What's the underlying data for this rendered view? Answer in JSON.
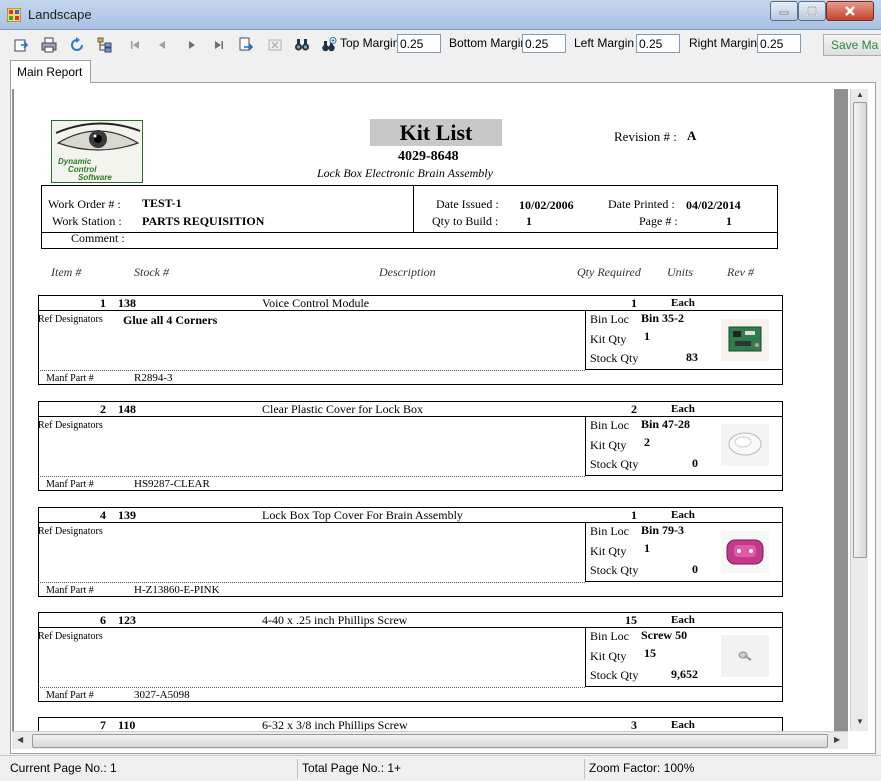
{
  "window": {
    "title": "Landscape"
  },
  "toolbar": {
    "top_margin_label": "Top Margin",
    "top_margin_value": "0.25",
    "bottom_margin_label": "Bottom Margin",
    "bottom_margin_value": "0.25",
    "left_margin_label": "Left Margin",
    "left_margin_value": "0.25",
    "right_margin_label": "Right Margin",
    "right_margin_value": "0.25",
    "save_label": "Save Ma"
  },
  "tabs": [
    {
      "label": "Main Report"
    }
  ],
  "report": {
    "logo_text": [
      "Dynamic",
      "Control",
      "Software"
    ],
    "title": "Kit List",
    "kit_number": "4029-8648",
    "kit_description": "Lock Box Electronic Brain Assembly",
    "revision_label": "Revision # :",
    "revision_value": "A",
    "header": {
      "work_order_label": "Work Order # :",
      "work_order_value": "TEST-1",
      "work_station_label": "Work Station :",
      "work_station_value": "PARTS REQUISITION",
      "comment_label": "Comment :",
      "date_issued_label": "Date Issued :",
      "date_issued_value": "10/02/2006",
      "qty_to_build_label": "Qty to Build :",
      "qty_to_build_value": "1",
      "date_printed_label": "Date Printed :",
      "date_printed_value": "04/02/2014",
      "page_label": "Page # :",
      "page_value": "1"
    },
    "columns": {
      "item": "Item #",
      "stock": "Stock #",
      "description": "Description",
      "qty_required": "Qty Required",
      "units": "Units",
      "rev": "Rev #"
    },
    "field_labels": {
      "ref_designators": "Ref Designators",
      "manf_part": "Manf Part #",
      "bin_loc": "Bin Loc",
      "kit_qty": "Kit Qty",
      "stock_qty": "Stock Qty"
    },
    "items": [
      {
        "item": "1",
        "stock": "138",
        "description": "Voice Control Module",
        "qty": "1",
        "units": "Each",
        "ref_designators": "Glue all 4 Corners",
        "manf_part": "R2894-3",
        "bin_loc": "Bin 35-2",
        "kit_qty": "1",
        "stock_qty": "83",
        "image": "circuit-board-image"
      },
      {
        "item": "2",
        "stock": "148",
        "description": "Clear Plastic Cover for Lock Box",
        "qty": "2",
        "units": "Each",
        "ref_designators": "",
        "manf_part": "HS9287-CLEAR",
        "bin_loc": "Bin 47-28",
        "kit_qty": "2",
        "stock_qty": "0",
        "image": "clear-cover-image"
      },
      {
        "item": "4",
        "stock": "139",
        "description": "Lock Box Top Cover For Brain Assembly",
        "qty": "1",
        "units": "Each",
        "ref_designators": "",
        "manf_part": "H-Z13860-E-PINK",
        "bin_loc": "Bin 79-3",
        "kit_qty": "1",
        "stock_qty": "0",
        "image": "pink-cover-image"
      },
      {
        "item": "6",
        "stock": "123",
        "description": "4-40 x .25 inch Phillips Screw",
        "qty": "15",
        "units": "Each",
        "ref_designators": "",
        "manf_part": "3027-A5098",
        "bin_loc": "Screw 50",
        "kit_qty": "15",
        "stock_qty": "9,652",
        "image": "screw-image"
      },
      {
        "item": "7",
        "stock": "110",
        "description": "6-32 x 3/8 inch Phillips Screw",
        "qty": "3",
        "units": "Each"
      }
    ]
  },
  "status": {
    "current_page": "Current Page No.: 1",
    "total_page": "Total Page No.: 1+",
    "zoom": "Zoom Factor: 100%"
  }
}
